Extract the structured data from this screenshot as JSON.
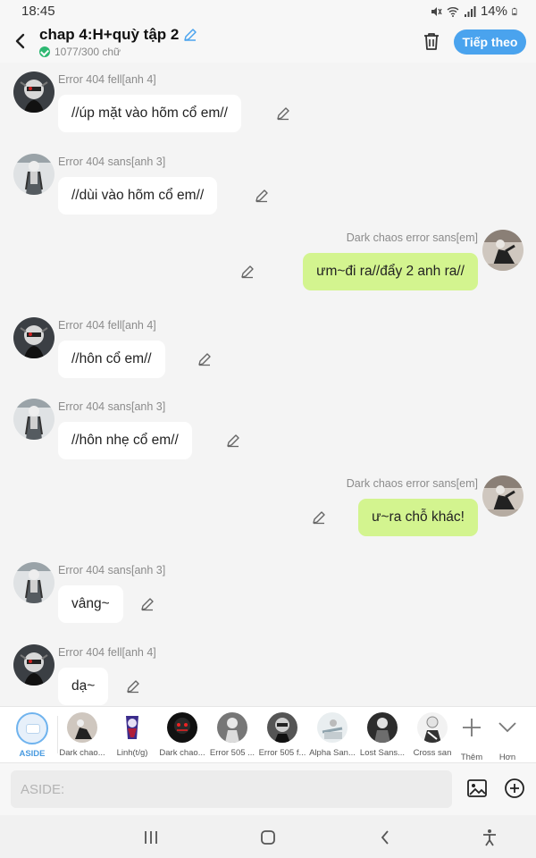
{
  "status": {
    "time": "18:45",
    "battery": "14%"
  },
  "header": {
    "title": "chap 4:H+quỳ tập 2",
    "word_count": "1077/300 chữ",
    "next_label": "Tiếp theo"
  },
  "messages": [
    {
      "side": "left",
      "name": "Error 404 fell[anh 4]",
      "text": "//úp mặt vào hõm cổ em//",
      "avatar": "fell"
    },
    {
      "side": "left",
      "name": "Error 404 sans[anh 3]",
      "text": "//dùi vào hõm cổ em//",
      "avatar": "sans"
    },
    {
      "side": "right",
      "name": "Dark chaos error sans[em]",
      "text": "ưm~đi ra//đẩy 2 anh ra//",
      "avatar": "dark"
    },
    {
      "side": "left",
      "name": "Error 404 fell[anh 4]",
      "text": "//hôn cổ em//",
      "avatar": "fell"
    },
    {
      "side": "left",
      "name": "Error 404 sans[anh 3]",
      "text": "//hôn nhẹ cổ em//",
      "avatar": "sans"
    },
    {
      "side": "right",
      "name": "Dark chaos error sans[em]",
      "text": "ư~ra chỗ khác!",
      "avatar": "dark"
    },
    {
      "side": "left",
      "name": "Error 404 sans[anh 3]",
      "text": "vâng~",
      "avatar": "sans"
    },
    {
      "side": "left",
      "name": "Error 404 fell[anh 4]",
      "text": "dạ~",
      "avatar": "fell"
    }
  ],
  "characters": [
    {
      "label": "ASIDE"
    },
    {
      "label": "Dark chao..."
    },
    {
      "label": "Linh(t/g)"
    },
    {
      "label": "Dark chao..."
    },
    {
      "label": "Error 505 ..."
    },
    {
      "label": "Error 505 f..."
    },
    {
      "label": "Alpha San..."
    },
    {
      "label": "Lost Sans..."
    },
    {
      "label": "Cross san"
    },
    {
      "label": "Thêm"
    },
    {
      "label": "Hơn"
    }
  ],
  "input": {
    "placeholder": "ASIDE:"
  },
  "icons": {
    "back": "chevron-left-icon",
    "edit_title": "pencil-icon",
    "trash": "trash-icon",
    "message_edit": "pencil-icon",
    "more_characters": "plus-icon",
    "expand": "chevron-down-icon",
    "image": "image-icon",
    "add": "plus-circle-icon",
    "nav": [
      "recent-apps-icon",
      "home-icon",
      "back-icon",
      "accessibility-icon"
    ]
  },
  "colors": {
    "accent": "#4aa3ee",
    "own_bubble": "#d3f48f",
    "other_bubble": "#ffffff",
    "verified": "#2eb872"
  }
}
